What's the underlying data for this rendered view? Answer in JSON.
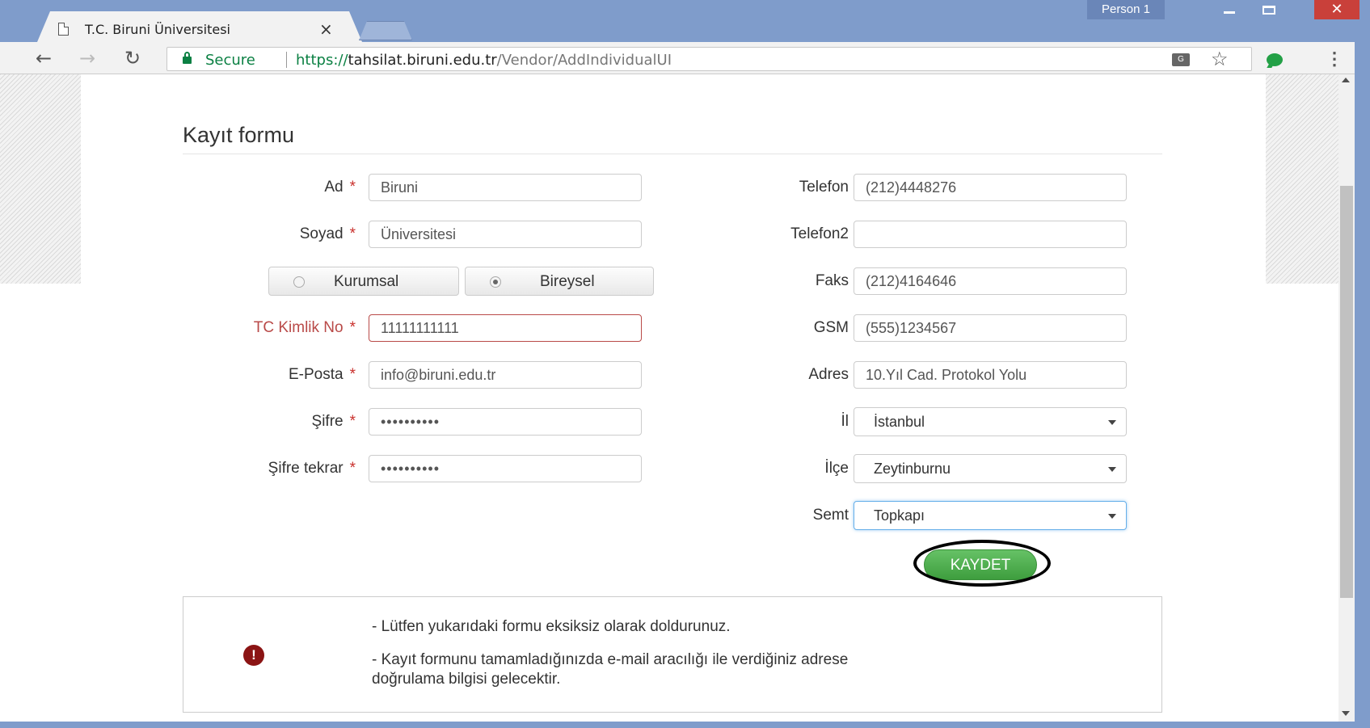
{
  "browser": {
    "tab_title": "T.C. Biruni Üniversitesi",
    "tab_close": "×",
    "profile": "Person 1",
    "secure_label": "Secure",
    "url_scheme": "https://",
    "url_host": "tahsilat.biruni.edu.tr",
    "url_path": "/Vendor/AddIndividualUI",
    "close_glyph": "✕"
  },
  "form": {
    "title": "Kayıt formu",
    "required_mark": "*",
    "left": {
      "ad": {
        "label": "Ad",
        "value": "Biruni"
      },
      "soyad": {
        "label": "Soyad",
        "value": "Üniversitesi"
      },
      "type_options": [
        {
          "label": "Kurumsal",
          "checked": false
        },
        {
          "label": "Bireysel",
          "checked": true
        }
      ],
      "tc": {
        "label": "TC Kimlik No",
        "value": "11111111111"
      },
      "eposta": {
        "label": "E-Posta",
        "value": "info@biruni.edu.tr"
      },
      "sifre": {
        "label": "Şifre",
        "value": "••••••••••"
      },
      "sifre_tekrar": {
        "label": "Şifre tekrar",
        "value": "••••••••••"
      }
    },
    "right": {
      "telefon": {
        "label": "Telefon",
        "value": "(212)4448276"
      },
      "telefon2": {
        "label": "Telefon2",
        "value": ""
      },
      "faks": {
        "label": "Faks",
        "value": "(212)4164646"
      },
      "gsm": {
        "label": "GSM",
        "value": "(555)1234567"
      },
      "adres": {
        "label": "Adres",
        "value": "10.Yıl Cad. Protokol Yolu"
      },
      "il": {
        "label": "İl",
        "value": "İstanbul"
      },
      "ilce": {
        "label": "İlçe",
        "value": "Zeytinburnu"
      },
      "semt": {
        "label": "Semt",
        "value": "Topkapı"
      }
    },
    "save_label": "KAYDET"
  },
  "info": {
    "icon": "!",
    "line1": "- Lütfen yukarıdaki formu eksiksiz olarak doldurunuz.",
    "line2a": "- Kayıt formunu tamamladığınızda e-mail aracılığı ile verdiğiniz adrese",
    "line2b": "doğrulama bilgisi gelecektir."
  },
  "colors": {
    "window_frame": "#7f9ccb",
    "error": "#b94a48",
    "save_button": "#4cae4c",
    "alert_icon": "#8b1414"
  }
}
